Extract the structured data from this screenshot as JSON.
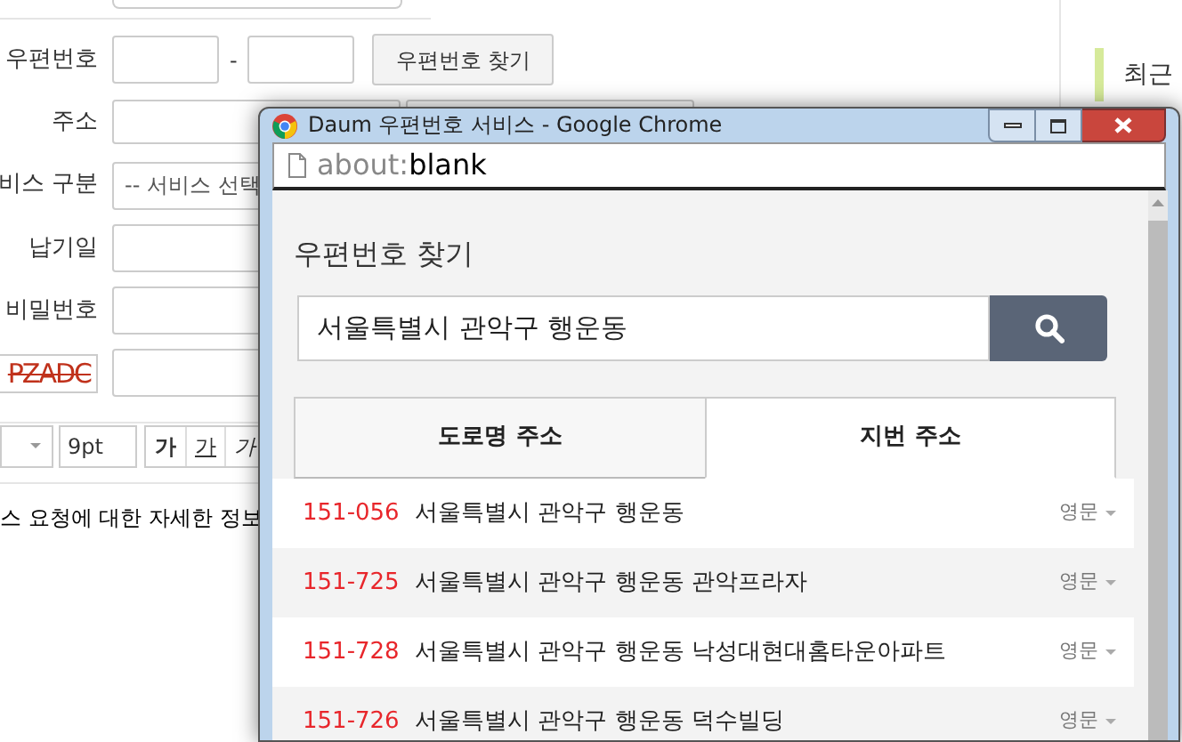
{
  "form": {
    "rows": [
      {
        "kind": "postcode",
        "label": "우편번호",
        "separator": "-",
        "button": "우편번호 찾기"
      },
      {
        "kind": "address",
        "label": "주소"
      },
      {
        "kind": "select",
        "label": "비스 구분",
        "value": "-- 서비스 선택"
      },
      {
        "kind": "text",
        "label": "납기일"
      },
      {
        "kind": "text",
        "label": "비밀번호"
      },
      {
        "kind": "captcha",
        "captcha": "PZADC"
      }
    ],
    "toolbar": {
      "size": "9pt",
      "buttons": [
        {
          "kind": "bold",
          "label": "가"
        },
        {
          "kind": "underline",
          "label": "가"
        },
        {
          "kind": "italic",
          "label": "가"
        }
      ]
    },
    "body_text": "스 요청에 대한 자세한 정보"
  },
  "sidebar": {
    "heading": "최근"
  },
  "popup": {
    "title": "Daum 우편번호 서비스 - Google Chrome",
    "address": {
      "scheme": "about:",
      "path": "blank"
    },
    "heading": "우편번호 찾기",
    "search": {
      "value": "서울특별시 관악구 행운동"
    },
    "tabs": [
      {
        "label": "도로명 주소",
        "selected": false
      },
      {
        "label": "지번 주소",
        "selected": true
      }
    ],
    "results": [
      {
        "code": "151-056",
        "address": "서울특별시 관악구 행운동",
        "english": "영문"
      },
      {
        "code": "151-725",
        "address": "서울특별시 관악구 행운동 관악프라자",
        "english": "영문"
      },
      {
        "code": "151-728",
        "address": "서울특별시 관악구 행운동 낙성대현대홈타운아파트",
        "english": "영문"
      },
      {
        "code": "151-726",
        "address": "서울특별시 관악구 행운동 덕수빌딩",
        "english": "영문"
      }
    ]
  }
}
